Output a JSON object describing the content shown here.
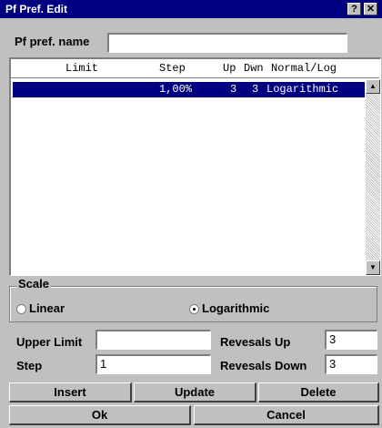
{
  "window": {
    "title": "Pf Pref. Edit",
    "help_label": "?",
    "close_label": "✕"
  },
  "name_field": {
    "label": "Pf pref. name",
    "value": ""
  },
  "list": {
    "headers": {
      "limit": "Limit",
      "step": "Step",
      "up": "Up",
      "dwn": "Dwn",
      "normal_log": "Normal/Log"
    },
    "rows": [
      {
        "limit": "",
        "step": "1,00%",
        "up": "3",
        "dwn": "3",
        "normal_log": "Logarithmic",
        "selected": true
      }
    ]
  },
  "scale": {
    "label": "Scale",
    "linear_label": "Linear",
    "log_label": "Logarithmic",
    "selected": "Logarithmic"
  },
  "params": {
    "upper_limit_label": "Upper Limit",
    "upper_limit_value": "",
    "step_label": "Step",
    "step_value": "1",
    "rev_up_label": "Revesals Up",
    "rev_up_value": "3",
    "rev_down_label": "Revesals Down",
    "rev_down_value": "3"
  },
  "buttons": {
    "insert": "Insert",
    "update": "Update",
    "delete": "Delete",
    "ok": "Ok",
    "cancel": "Cancel"
  },
  "colors": {
    "titlebar": "#000080",
    "face": "#c0c0c0",
    "selection": "#000080"
  }
}
